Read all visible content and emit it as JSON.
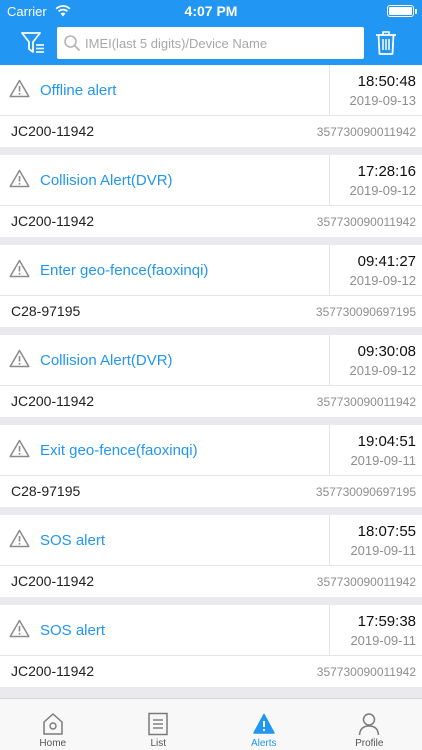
{
  "status_bar": {
    "carrier": "Carrier",
    "time": "4:07 PM"
  },
  "search": {
    "placeholder": "IMEI(last 5 digits)/Device Name",
    "value": ""
  },
  "colors": {
    "accent": "#2196f3",
    "background": "#e9e9ee",
    "inactive": "#7a7a7a"
  },
  "alerts": [
    {
      "type": "Offline alert",
      "time": "18:50:48",
      "date": "2019-09-13",
      "device": "JC200-11942",
      "imei": "357730090011942"
    },
    {
      "type": "Collision Alert(DVR)",
      "time": "17:28:16",
      "date": "2019-09-12",
      "device": "JC200-11942",
      "imei": "357730090011942"
    },
    {
      "type": "Enter geo-fence(faoxinqi)",
      "time": "09:41:27",
      "date": "2019-09-12",
      "device": "C28-97195",
      "imei": "357730090697195"
    },
    {
      "type": "Collision Alert(DVR)",
      "time": "09:30:08",
      "date": "2019-09-12",
      "device": "JC200-11942",
      "imei": "357730090011942"
    },
    {
      "type": "Exit geo-fence(faoxinqi)",
      "time": "19:04:51",
      "date": "2019-09-11",
      "device": "C28-97195",
      "imei": "357730090697195"
    },
    {
      "type": "SOS alert",
      "time": "18:07:55",
      "date": "2019-09-11",
      "device": "JC200-11942",
      "imei": "357730090011942"
    },
    {
      "type": "SOS alert",
      "time": "17:59:38",
      "date": "2019-09-11",
      "device": "JC200-11942",
      "imei": "357730090011942"
    }
  ],
  "tabs": [
    {
      "label": "Home",
      "icon": "home-icon",
      "active": false
    },
    {
      "label": "List",
      "icon": "list-icon",
      "active": false
    },
    {
      "label": "Alerts",
      "icon": "alert-icon",
      "active": true
    },
    {
      "label": "Profile",
      "icon": "profile-icon",
      "active": false
    }
  ]
}
